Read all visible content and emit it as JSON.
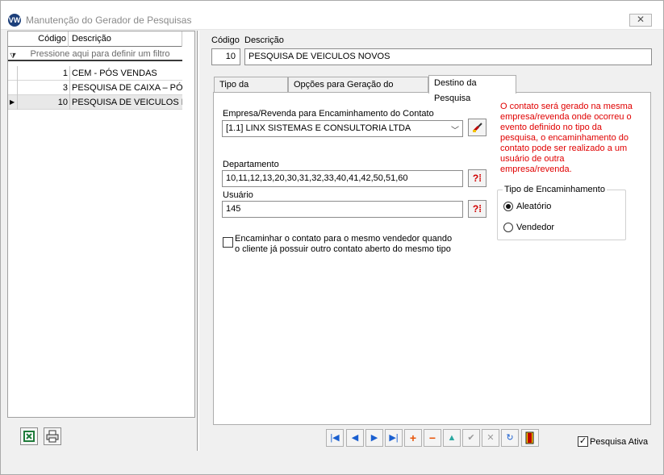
{
  "window": {
    "title": "Manutenção do Gerador de Pesquisas",
    "logo_icon": "vw-logo",
    "close_label": "✕"
  },
  "list": {
    "header_code": "Código",
    "header_desc": "Descrição",
    "filter_placeholder": "Pressione aqui para definir um filtro",
    "rows": [
      {
        "code": "1",
        "desc": "CEM - PÓS VENDAS",
        "selected": false
      },
      {
        "code": "3",
        "desc": "PESQUISA DE CAIXA – PÓS",
        "selected": false
      },
      {
        "code": "10",
        "desc": "PESQUISA DE VEICULOS NO",
        "selected": true
      }
    ],
    "buttons": [
      "excel-export-icon",
      "print-icon"
    ]
  },
  "record": {
    "code_label": "Código",
    "desc_label": "Descrição",
    "code_value": "10",
    "desc_value": "PESQUISA DE VEICULOS NOVOS"
  },
  "tabs": [
    {
      "label": "Tipo da Pesquisa",
      "active": false
    },
    {
      "label": "Opções para Geração do Contato",
      "active": false
    },
    {
      "label": "Destino da Pesquisa",
      "active": true
    }
  ],
  "destino": {
    "empresa_label": "Empresa/Revenda  para Encaminhamento do Contato",
    "empresa_value": "[1.1] LINX SISTEMAS E CONSULTORIA LTDA",
    "departamento_label": "Departamento",
    "departamento_value": "10,11,12,13,20,30,31,32,33,40,41,42,50,51,60",
    "usuario_label": "Usuário",
    "usuario_value": "145",
    "note": "O contato será gerado na mesma empresa/revenda onde ocorreu o evento definido no tipo da pesquisa, o encaminhamento do contato pode ser realizado a um usuário de outra empresa/revenda.",
    "encaminhar_label_1": "Encaminhar o contato para o mesmo vendedor quando",
    "encaminhar_label_2": "o cliente já possuir outro contato aberto do mesmo tipo",
    "encaminhar_checked": false,
    "tipo_title": "Tipo de Encaminhamento",
    "tipo_options": [
      "Aleatório",
      "Vendedor"
    ],
    "tipo_selected": "Aleatório"
  },
  "footer": {
    "ativa_label": "Pesquisa Ativa",
    "ativa_checked": true
  },
  "colors": {
    "note_red": "#e00000",
    "nav_blue": "#1a5fd0",
    "add_orange": "#e8550a",
    "teal": "#2aa7a0"
  }
}
